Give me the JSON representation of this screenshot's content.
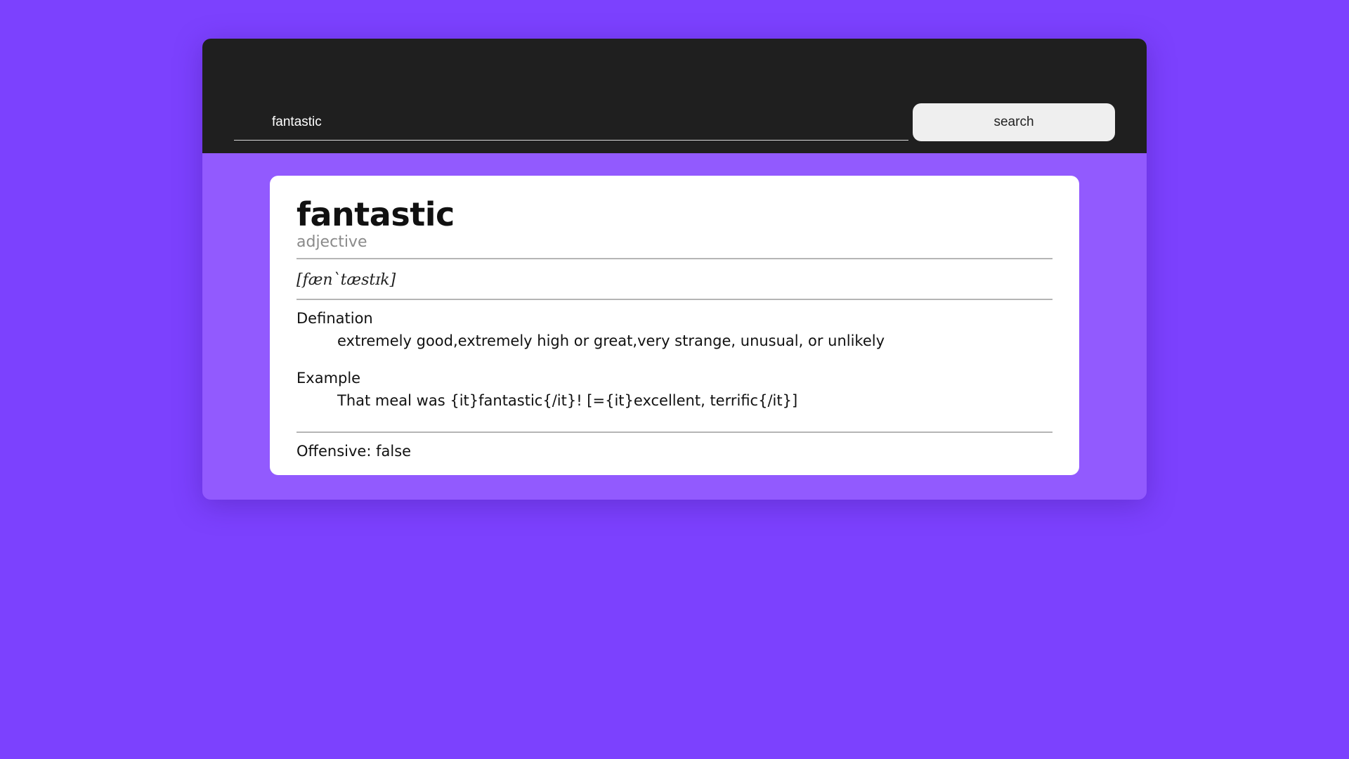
{
  "search": {
    "value": "fantastic",
    "button_label": "search"
  },
  "entry": {
    "word": "fantastic",
    "part_of_speech": "adjective",
    "phonetic": "[fæn`tæstɪk]",
    "definition_label": "Defination",
    "definition": "extremely good,extremely high or great,very strange, unusual, or unlikely",
    "example_label": "Example",
    "example": "That meal was {it}fantastic{/it}! [={it}excellent, terrific{/it}]",
    "offensive_text": "Offensive: false"
  },
  "colors": {
    "background": "#7c41fe",
    "app_panel": "#925afe",
    "header": "#1f1f1f",
    "card": "#ffffff",
    "button": "#efefef"
  }
}
